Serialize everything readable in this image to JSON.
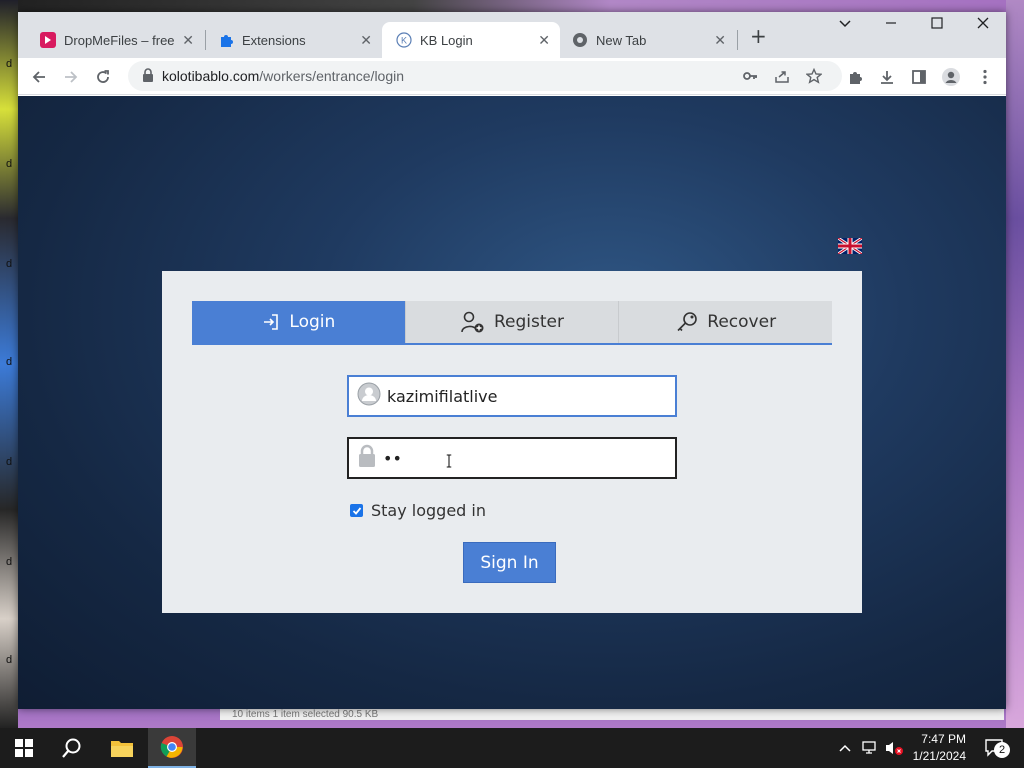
{
  "desktop": {
    "icon_labels": [
      "d",
      "d",
      "d",
      "d",
      "d",
      "d",
      "d"
    ],
    "explorer_status": "10 items    1 item selected  90.5 KB"
  },
  "browser": {
    "tabs": [
      {
        "title": "DropMeFiles – free o",
        "icon": "dropmefiles-icon",
        "active": false
      },
      {
        "title": "Extensions",
        "icon": "puzzle-icon",
        "active": false
      },
      {
        "title": "KB Login",
        "icon": "kb-icon",
        "active": true
      },
      {
        "title": "New Tab",
        "icon": "chrome-icon",
        "active": false
      }
    ],
    "url_host": "kolotibablo.com",
    "url_path": "/workers/entrance/login"
  },
  "login": {
    "tabs": [
      {
        "label": "Login",
        "icon": "login-arrow-icon",
        "active": true
      },
      {
        "label": "Register",
        "icon": "user-add-icon",
        "active": false
      },
      {
        "label": "Recover",
        "icon": "key-icon",
        "active": false
      }
    ],
    "username_value": "kazimifilatlive",
    "password_value": "••",
    "stay_logged_in_label": "Stay logged in",
    "stay_logged_in_checked": true,
    "signin_label": "Sign In",
    "language_flag": "uk-flag-icon"
  },
  "taskbar": {
    "time": "7:47 PM",
    "date": "1/21/2024",
    "notification_count": "2"
  },
  "colors": {
    "accent": "#4a7fd4",
    "page_bg": "#1f3a60",
    "card_bg": "#e9ecef"
  }
}
